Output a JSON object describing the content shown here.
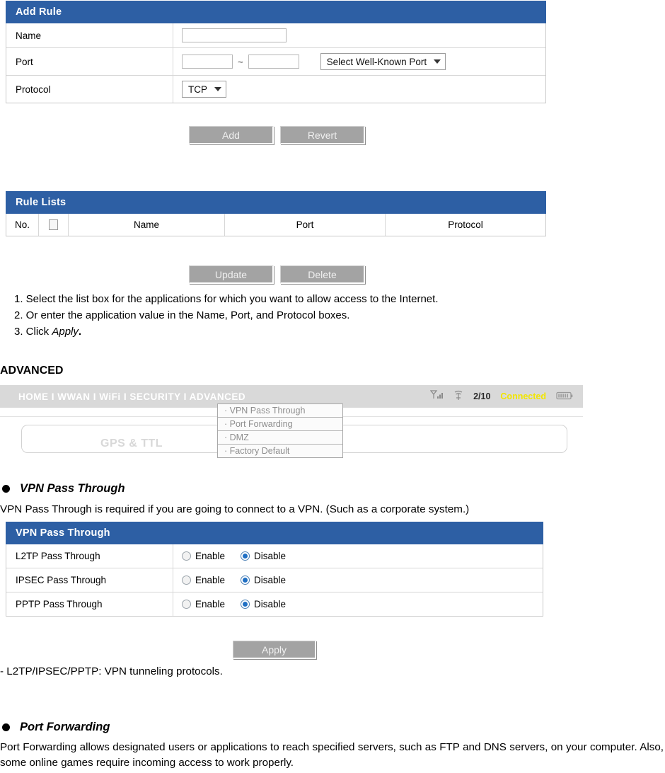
{
  "add_rule": {
    "title": "Add Rule",
    "rows": [
      {
        "label": "Name",
        "type": "text",
        "value": ""
      },
      {
        "label": "Port",
        "type": "range",
        "from": "",
        "to": "",
        "tilde": "~",
        "select_label": "Select Well-Known Port"
      },
      {
        "label": "Protocol",
        "type": "select",
        "select_label": "TCP"
      }
    ],
    "buttons": [
      {
        "label": "Add"
      },
      {
        "label": "Revert"
      }
    ]
  },
  "rule_lists": {
    "title": "Rule Lists",
    "columns": [
      "No.",
      "",
      "Name",
      "Port",
      "Protocol"
    ],
    "rows": [],
    "buttons": [
      {
        "label": "Update"
      },
      {
        "label": "Delete"
      }
    ]
  },
  "instructions": [
    "1. Select the list box for the applications for which you want to allow access to the Internet.",
    "2. Or enter the application value in the Name, Port, and Protocol boxes.",
    "3. Click Apply."
  ],
  "instruction_3": {
    "prefix": "3. Click ",
    "italic": "Apply",
    "suffix": "."
  },
  "advanced": {
    "heading": "ADVANCED",
    "device": {
      "nav": "HOME I WWAN I WiFi I SECURITY I ADVANCED",
      "signal_count": "2/10",
      "connection_status": "Connected",
      "connection_color": "#f2e600",
      "menu_items": [
        "· VPN Pass Through",
        "· Port Forwarding",
        "· DMZ",
        "· Factory Default"
      ],
      "ghost_text": "GPS & TTL"
    }
  },
  "vpn": {
    "bullet_heading": "VPN Pass Through",
    "description": "VPN Pass Through is required if you are going to connect to a VPN. (Such as a corporate system.)",
    "panel_title": "VPN Pass Through",
    "rows": [
      {
        "label": "L2TP Pass Through",
        "enable_label": "Enable",
        "disable_label": "Disable",
        "selected": "Disable"
      },
      {
        "label": "IPSEC Pass Through",
        "enable_label": "Enable",
        "disable_label": "Disable",
        "selected": "Disable"
      },
      {
        "label": "PPTP Pass Through",
        "enable_label": "Enable",
        "disable_label": "Disable",
        "selected": "Disable"
      }
    ],
    "apply_button": "Apply",
    "note": "-  L2TP/IPSEC/PPTP: VPN tunneling protocols."
  },
  "port_forwarding": {
    "bullet_heading": "Port Forwarding",
    "description": "Port Forwarding allows designated users or applications to reach specified servers, such as FTP and DNS servers, on your computer. Also, some online games require incoming access to work properly."
  },
  "colors": {
    "panel_blue": "#2d5fa4",
    "button_grey": "#a3a3a3",
    "radio_blue": "#1f6fc4",
    "status_yellow": "#f2e600"
  }
}
